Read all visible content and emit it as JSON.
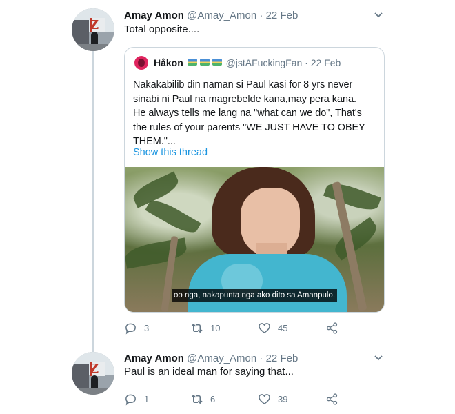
{
  "tweets": [
    {
      "author_name": "Amay Amon",
      "handle": "@Amay_Amon",
      "separator": "·",
      "date": "22 Feb",
      "text": "Total opposite....",
      "quote": {
        "author_name": "Håkon",
        "handle": "@jstAFuckingFan",
        "separator": "·",
        "date": "22 Feb",
        "lines": [
          "Nakakabilib din naman si Paul kasi for 8 yrs never",
          "sinabi ni Paul na magrebelde kana,may pera kana.",
          "He always tells me lang na \"what can we do\", That's",
          "the rules of your parents \"WE JUST HAVE TO OBEY",
          "THEM.\"..."
        ],
        "show_thread": "Show this thread",
        "video_subtitle": "oo nga, nakapunta nga ako dito sa Amanpulo,"
      },
      "replies": "3",
      "retweets": "10",
      "likes": "45"
    },
    {
      "author_name": "Amay Amon",
      "handle": "@Amay_Amon",
      "separator": "·",
      "date": "22 Feb",
      "text": "Paul is an ideal man for saying that...",
      "replies": "1",
      "retweets": "6",
      "likes": "39"
    }
  ],
  "icons": {
    "reply": "reply-icon",
    "retweet": "retweet-icon",
    "like": "heart-icon",
    "share": "share-icon",
    "more": "chevron-down-icon"
  },
  "colors": {
    "link": "#1b95e0",
    "secondary_text": "#657786",
    "thread_line": "#ccd6dd"
  }
}
